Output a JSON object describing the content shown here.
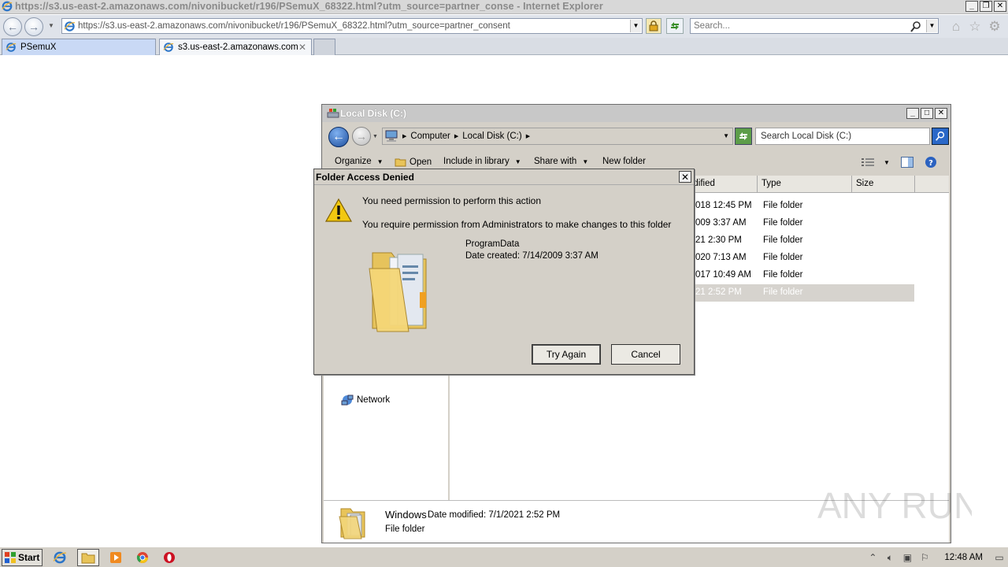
{
  "ie": {
    "title": "https://s3.us-east-2.amazonaws.com/nivonibucket/r196/PSemuX_68322.html?utm_source=partner_conse - Internet Explorer",
    "url": "https://s3.us-east-2.amazonaws.com/nivonibucket/r196/PSemuX_68322.html?utm_source=partner_consent",
    "search_placeholder": "Search...",
    "tabs": [
      {
        "label": "PSemuX",
        "active": false
      },
      {
        "label": "s3.us-east-2.amazonaws.com",
        "active": true
      }
    ]
  },
  "explorer": {
    "title": "Local Disk (C:)",
    "breadcrumb": [
      "Computer",
      "Local Disk (C:)"
    ],
    "search_placeholder": "Search Local Disk (C:)",
    "toolbar": {
      "organize": "Organize",
      "open": "Open",
      "include": "Include in library",
      "share": "Share with",
      "new_folder": "New folder"
    },
    "columns": {
      "modified": "odified",
      "type": "Type",
      "size": "Size"
    },
    "rows": [
      {
        "modified": "018 12:45 PM",
        "type": "File folder",
        "selected": false
      },
      {
        "modified": "009 3:37 AM",
        "type": "File folder",
        "selected": false
      },
      {
        "modified": "21 2:30 PM",
        "type": "File folder",
        "selected": false
      },
      {
        "modified": "020 7:13 AM",
        "type": "File folder",
        "selected": false
      },
      {
        "modified": "017 10:49 AM",
        "type": "File folder",
        "selected": false
      },
      {
        "modified": "21 2:52 PM",
        "type": "File folder",
        "selected": true
      }
    ],
    "nav_network": "Network",
    "details": {
      "name": "Windows",
      "meta": "Date modified: 7/1/2021 2:52 PM",
      "kind": "File folder"
    }
  },
  "dialog": {
    "title": "Folder Access Denied",
    "message1": "You need permission to perform this action",
    "message2": "You require permission from Administrators to make changes to this folder",
    "folder_name": "ProgramData",
    "folder_date": "Date created: 7/14/2009 3:37 AM",
    "try_again": "Try Again",
    "cancel": "Cancel"
  },
  "taskbar": {
    "start": "Start",
    "clock": "12:48 AM"
  },
  "watermark": "ANY RUN"
}
